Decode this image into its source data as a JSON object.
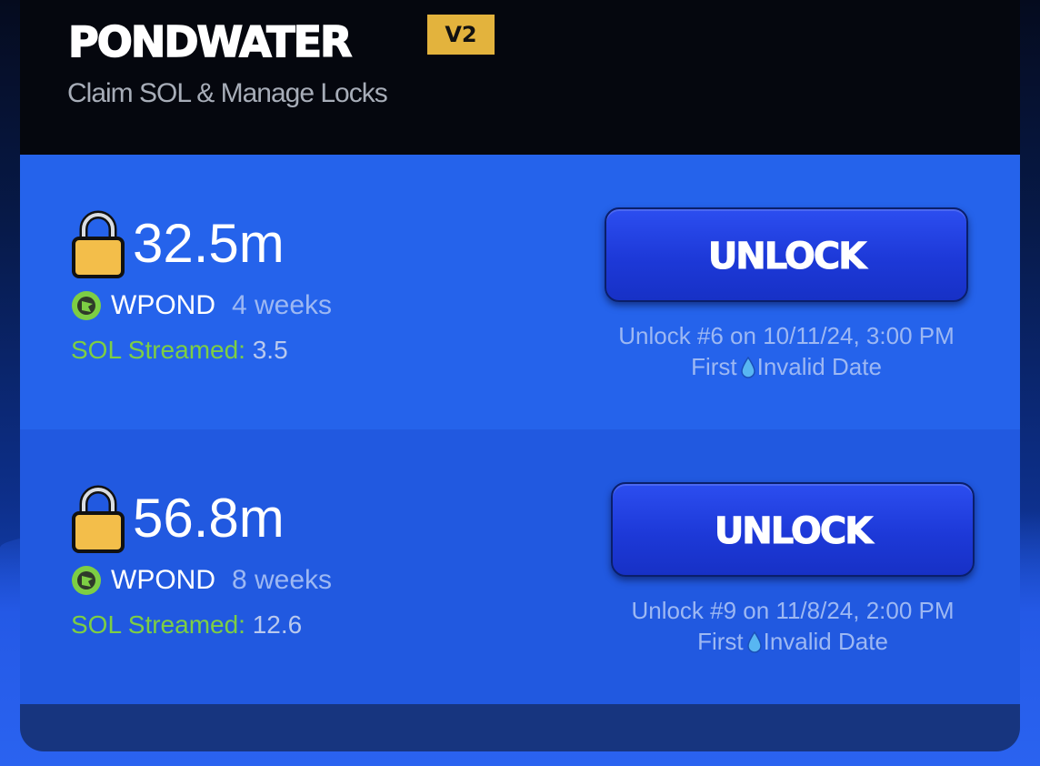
{
  "app": {
    "title": "PONDWATER",
    "version_badge": "V2",
    "subtitle": "Claim SOL & Manage Locks"
  },
  "locks": [
    {
      "amount": "32.5m",
      "token": "WPOND",
      "duration": "4 weeks",
      "streamed_label": "SOL Streamed:",
      "streamed_value": "3.5",
      "button_label": "UNLOCK",
      "unlock_text": "Unlock #6 on 10/11/24, 3:00 PM",
      "first_prefix": "First",
      "first_value": "Invalid Date"
    },
    {
      "amount": "56.8m",
      "token": "WPOND",
      "duration": "8 weeks",
      "streamed_label": "SOL Streamed:",
      "streamed_value": "12.6",
      "button_label": "UNLOCK",
      "unlock_text": "Unlock #9 on 11/8/24, 2:00 PM",
      "first_prefix": "First",
      "first_value": "Invalid Date"
    }
  ],
  "icons": {
    "lock": "padlock-icon",
    "token": "wpond-token-icon",
    "drop": "water-drop-icon"
  },
  "colors": {
    "accent_gold": "#e3b33d",
    "row_blue": "#2563eb",
    "streamed_green": "#7dce44",
    "button_blue": "#1d39d8"
  }
}
